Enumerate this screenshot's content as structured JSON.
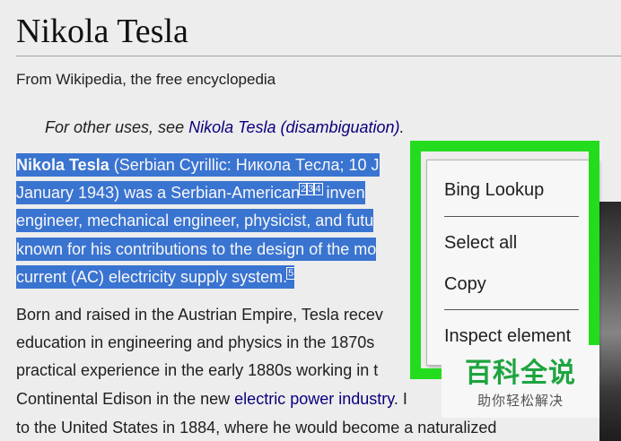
{
  "article": {
    "title": "Nikola Tesla",
    "tagline": "From Wikipedia, the free encyclopedia",
    "hatnote": {
      "prefix": "For other uses, see ",
      "link": "Nikola Tesla (disambiguation)",
      "suffix": "."
    },
    "selected_lines": [
      {
        "bold": "Nikola Tesla",
        "text": " (Serbian Cyrillic: Никола Тесла; 10 J"
      },
      {
        "text": "January 1943) was a Serbian-American",
        "refs": [
          "2",
          "3",
          "4"
        ],
        "after": " inven"
      },
      {
        "text": "engineer, mechanical engineer, physicist, and futu"
      },
      {
        "text": "known for his contributions to the design of the mo"
      },
      {
        "text": "current (AC) electricity supply system.",
        "refs": [
          "5"
        ]
      }
    ],
    "body_lines": [
      {
        "text": "Born and raised in the Austrian Empire, Tesla recev"
      },
      {
        "text": "education in engineering and physics in the 1870s"
      },
      {
        "text": "practical experience in the early 1880s working in t"
      },
      {
        "prefix": "Continental Edison in the new ",
        "link": "electric power industry",
        "suffix": ". I"
      },
      {
        "text": "to the United States in 1884, where he would become a naturalized"
      }
    ]
  },
  "context_menu": {
    "items": [
      "Bing Lookup",
      "Select all",
      "Copy",
      "Inspect element"
    ]
  },
  "watermark": {
    "title": "百科全说",
    "subtitle": "助你轻松解决"
  },
  "colors": {
    "selection": "#3c78d8",
    "highlight_frame": "#26e41f",
    "link": "#0b0080",
    "watermark": "#1faa42"
  }
}
